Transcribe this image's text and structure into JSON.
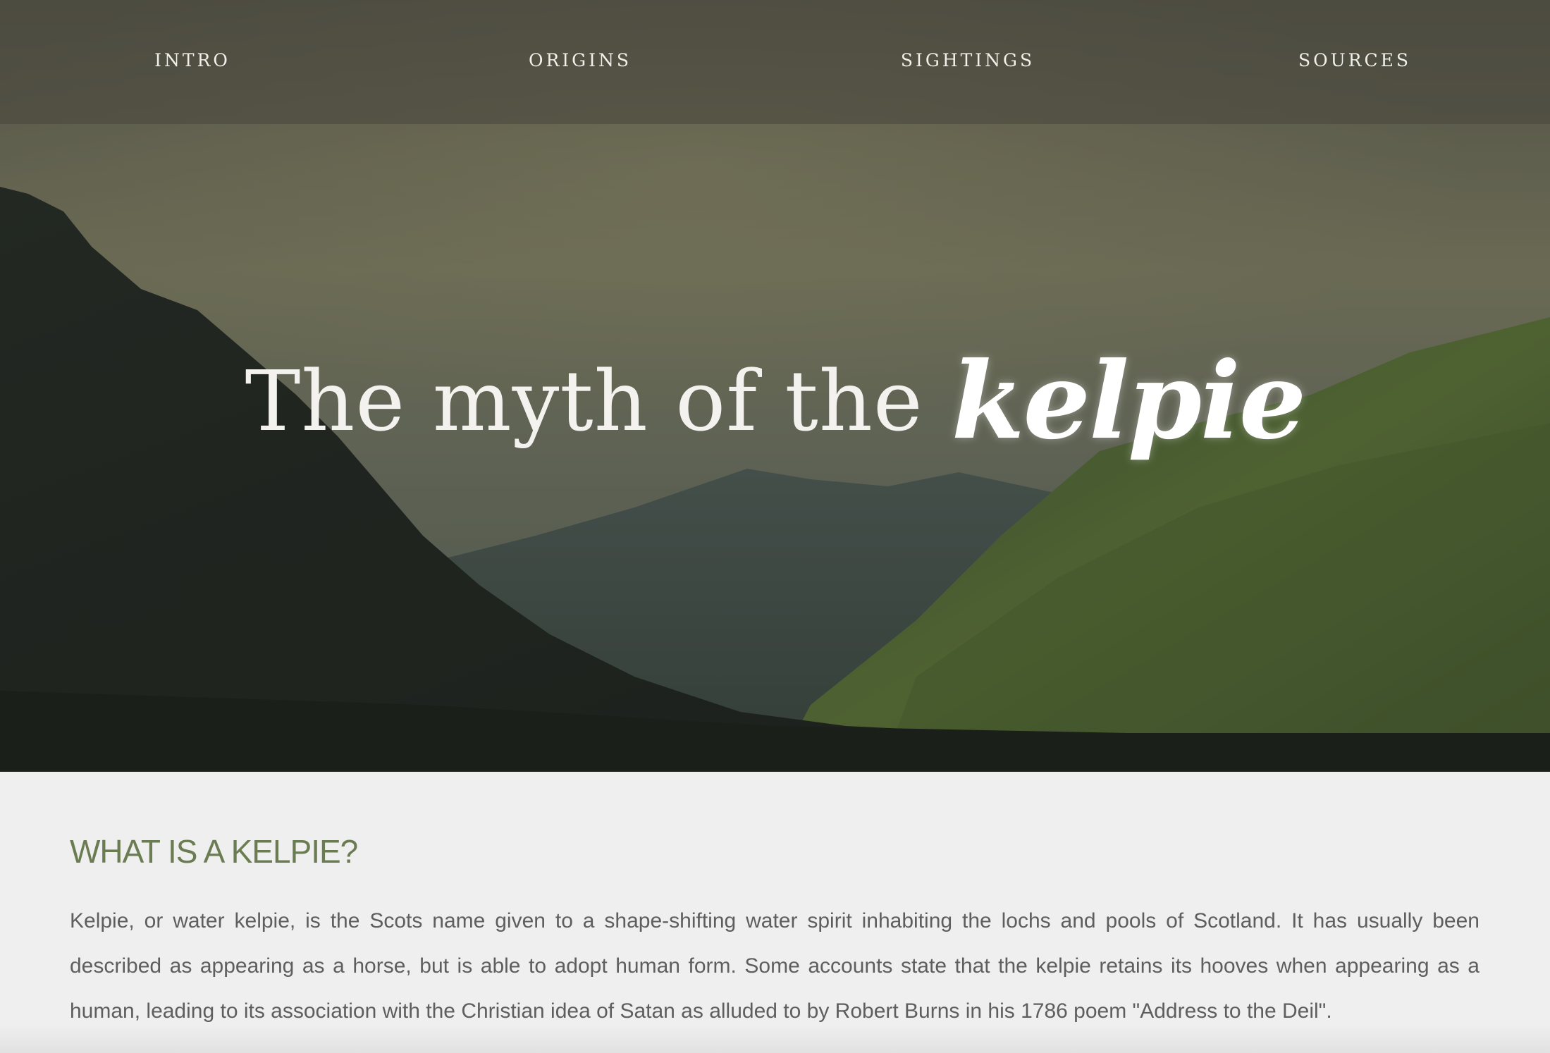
{
  "nav": {
    "items": [
      {
        "label": "INTRO"
      },
      {
        "label": "ORIGINS"
      },
      {
        "label": "SIGHTINGS"
      },
      {
        "label": "SOURCES"
      }
    ]
  },
  "hero": {
    "title_prefix": "The myth of the",
    "title_emphasis": "kelpie"
  },
  "content": {
    "heading": "WHAT IS A KELPIE?",
    "paragraph": "Kelpie, or water kelpie, is the Scots name given to a shape-shifting water spirit inhabiting the lochs and pools of Scotland. It has usually been described as appearing as a horse, but is able to adopt human form. Some accounts state that the kelpie retains its hooves when appearing as a human, leading to its association with the Christian idea of Satan as alluded to by Robert Burns in his 1786 poem \"Address to the Deil\"."
  },
  "colors": {
    "heading": "#6b7c52",
    "body_text": "#5e5e5e",
    "nav_text": "#f2f0ea",
    "content_bg": "#efefef"
  }
}
